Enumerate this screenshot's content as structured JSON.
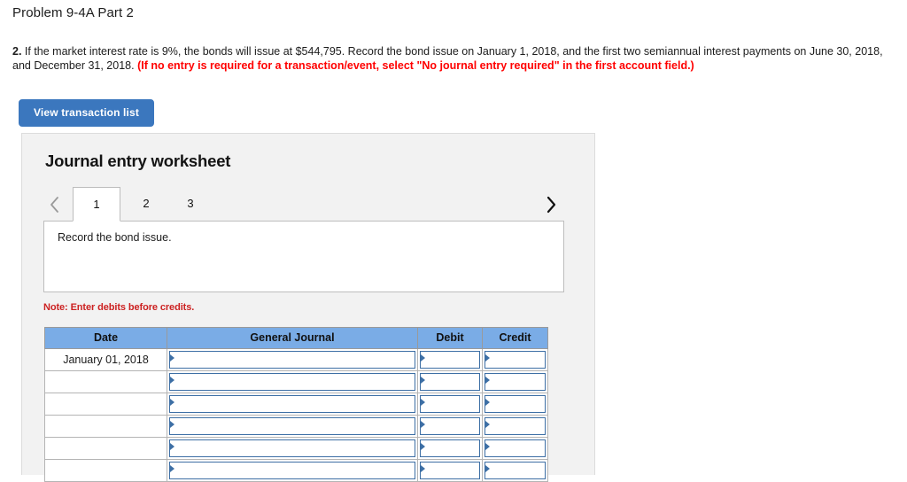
{
  "problem": {
    "title": "Problem 9-4A Part 2"
  },
  "instructions": {
    "number": "2.",
    "body_part1": " If the market interest rate is 9%, the bonds will issue at $544,795. Record the bond issue on January 1, 2018, and the first two semiannual interest payments on June 30, 2018, and December 31, 2018. ",
    "red_note": "(If no entry is required for a transaction/event, select \"No journal entry required\" in the first account field.)"
  },
  "toolbar": {
    "view_transaction_list_label": "View transaction list",
    "button_color": "#3b77be"
  },
  "worksheet": {
    "title": "Journal entry worksheet",
    "tabs": [
      {
        "label": "1",
        "active": true
      },
      {
        "label": "2",
        "active": false
      },
      {
        "label": "3",
        "active": false
      }
    ],
    "prev_arrow_icon": "chevron-left-icon",
    "next_arrow_icon": "chevron-right-icon",
    "description": "Record the bond issue.",
    "note": "Note: Enter debits before credits.",
    "note_color": "#cc2222"
  },
  "table": {
    "header_color": "#7aace6",
    "columns": [
      "Date",
      "General Journal",
      "Debit",
      "Credit"
    ],
    "rows": [
      {
        "date": "January 01, 2018",
        "general_journal": "",
        "debit": "",
        "credit": ""
      },
      {
        "date": "",
        "general_journal": "",
        "debit": "",
        "credit": ""
      },
      {
        "date": "",
        "general_journal": "",
        "debit": "",
        "credit": ""
      },
      {
        "date": "",
        "general_journal": "",
        "debit": "",
        "credit": ""
      },
      {
        "date": "",
        "general_journal": "",
        "debit": "",
        "credit": ""
      },
      {
        "date": "",
        "general_journal": "",
        "debit": "",
        "credit": ""
      }
    ]
  }
}
